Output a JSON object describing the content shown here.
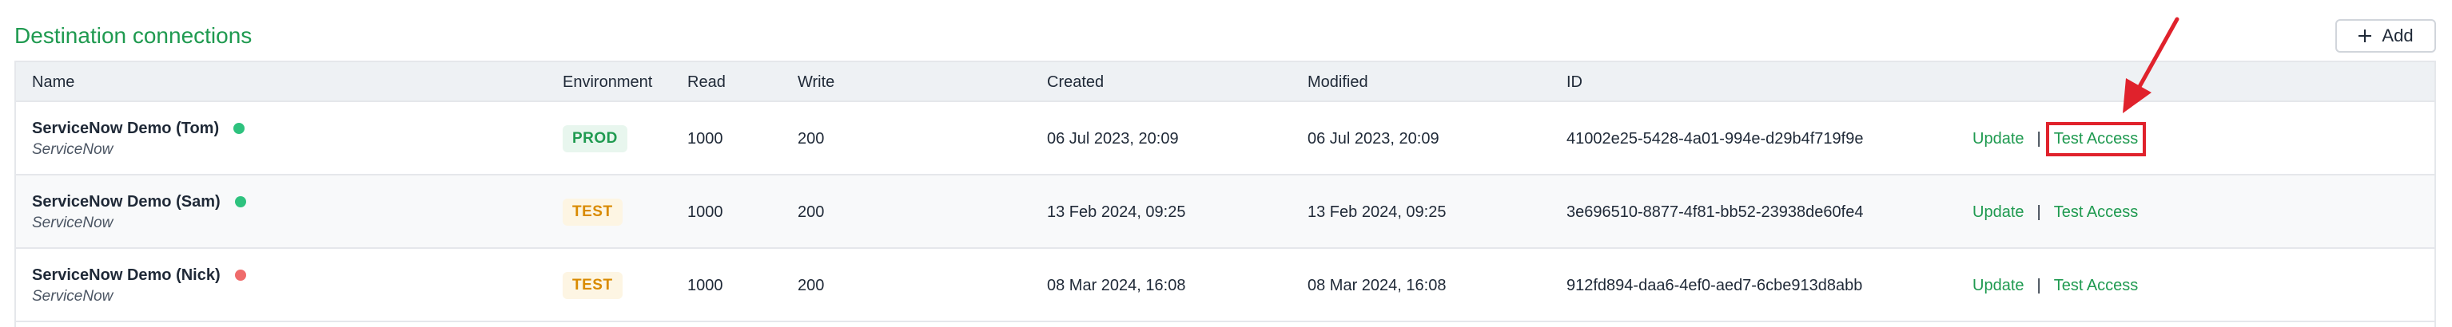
{
  "page": {
    "title": "Destination connections"
  },
  "toolbar": {
    "add_label": "Add",
    "add_icon": "plus-icon"
  },
  "table": {
    "columns": {
      "name": "Name",
      "environment": "Environment",
      "read": "Read",
      "write": "Write",
      "created": "Created",
      "modified": "Modified",
      "id": "ID"
    },
    "rows": [
      {
        "name": "ServiceNow Demo (Tom)",
        "type": "ServiceNow",
        "status": "online",
        "status_color": "#2ec27e",
        "environment": "PROD",
        "environment_fg": "#1f9a50",
        "environment_bg": "#e8f6ee",
        "read": "1000",
        "write": "200",
        "created": "06 Jul 2023, 20:09",
        "modified": "06 Jul 2023, 20:09",
        "id": "41002e25-5428-4a01-994e-d29b4f719f9e",
        "update_label": "Update",
        "separator": "|",
        "test_label": "Test Access"
      },
      {
        "name": "ServiceNow Demo (Sam)",
        "type": "ServiceNow",
        "status": "online",
        "status_color": "#2ec27e",
        "environment": "TEST",
        "environment_fg": "#d98a00",
        "environment_bg": "#fdf5e3",
        "read": "1000",
        "write": "200",
        "created": "13 Feb 2024, 09:25",
        "modified": "13 Feb 2024, 09:25",
        "id": "3e696510-8877-4f81-bb52-23938de60fe4",
        "update_label": "Update",
        "separator": "|",
        "test_label": "Test Access"
      },
      {
        "name": "ServiceNow Demo (Nick)",
        "type": "ServiceNow",
        "status": "offline",
        "status_color": "#ef6b6b",
        "environment": "TEST",
        "environment_fg": "#d98a00",
        "environment_bg": "#fdf5e3",
        "read": "1000",
        "write": "200",
        "created": "08 Mar 2024, 16:08",
        "modified": "08 Mar 2024, 16:08",
        "id": "912fd894-daa6-4ef0-aed7-6cbe913d8abb",
        "update_label": "Update",
        "separator": "|",
        "test_label": "Test Access"
      }
    ]
  },
  "annotation": {
    "color": "#e0222c",
    "arrow_icon": "red-arrow-icon"
  }
}
